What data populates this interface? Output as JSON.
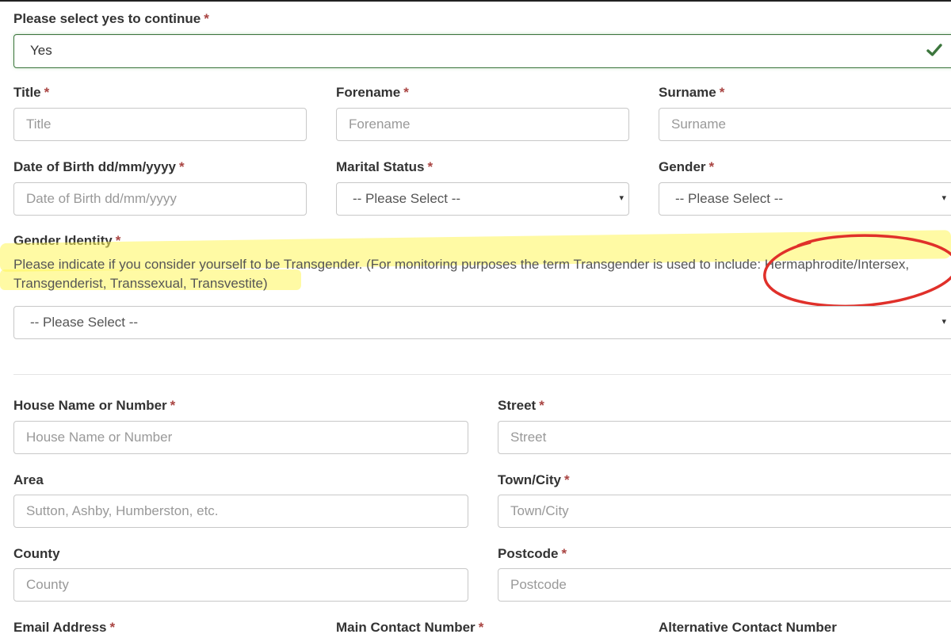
{
  "continue": {
    "label": "Please select yes to continue",
    "value": "Yes",
    "icon": "check-icon"
  },
  "required_marker": "*",
  "personal": {
    "title": {
      "label": "Title",
      "placeholder": "Title"
    },
    "forename": {
      "label": "Forename",
      "placeholder": "Forename"
    },
    "surname": {
      "label": "Surname",
      "placeholder": "Surname"
    },
    "dob": {
      "label": "Date of Birth dd/mm/yyyy",
      "placeholder": "Date of Birth dd/mm/yyyy"
    },
    "marital_status": {
      "label": "Marital Status",
      "value": "-- Please Select --"
    },
    "gender": {
      "label": "Gender",
      "value": "-- Please Select --"
    }
  },
  "gender_identity": {
    "label": "Gender Identity",
    "help_text": "Please indicate if you consider yourself to be Transgender. (For monitoring purposes the term Transgender is used to include: Hermaphrodite/Intersex, Transgenderist, Transsexual, Transvestite)",
    "value": "-- Please Select --"
  },
  "address": {
    "house": {
      "label": "House Name or Number",
      "placeholder": "House Name or Number"
    },
    "street": {
      "label": "Street",
      "placeholder": "Street"
    },
    "area": {
      "label": "Area",
      "placeholder": "Sutton, Ashby, Humberston, etc."
    },
    "town": {
      "label": "Town/City",
      "placeholder": "Town/City"
    },
    "county": {
      "label": "County",
      "placeholder": "County"
    },
    "postcode": {
      "label": "Postcode",
      "placeholder": "Postcode"
    }
  },
  "contact": {
    "email": {
      "label": "Email Address"
    },
    "main_phone": {
      "label": "Main Contact Number"
    },
    "alt_phone": {
      "label": "Alternative Contact Number"
    }
  },
  "colors": {
    "required": "#a94442",
    "success": "#3c763d",
    "highlight": "#fff55a",
    "annotation": "#e0302a"
  },
  "caret_glyph": "▾"
}
